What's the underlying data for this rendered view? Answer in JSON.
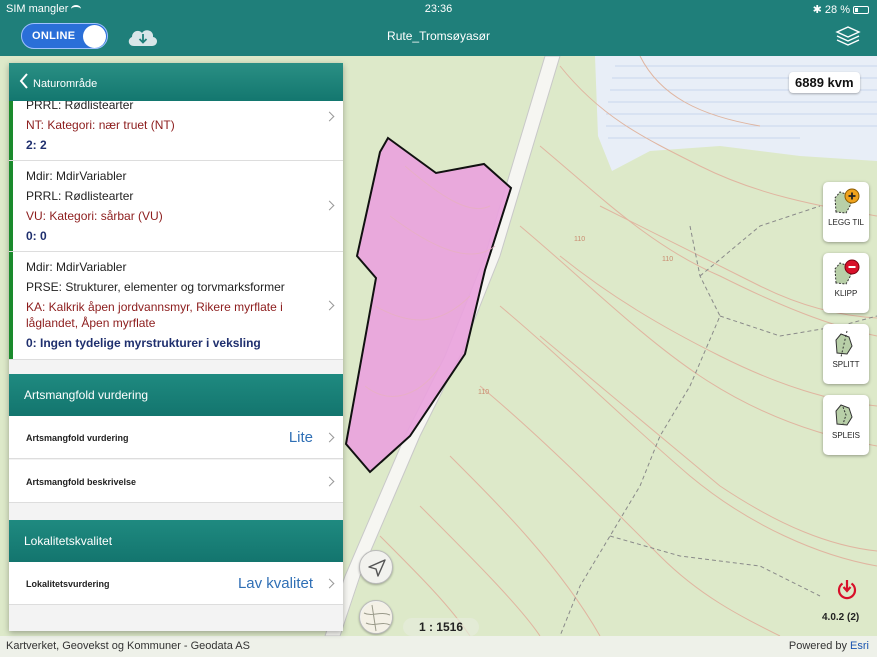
{
  "status_bar": {
    "carrier": "SIM mangler",
    "time": "23:36",
    "battery": "28 %"
  },
  "nav_bar": {
    "toggle_label": "ONLINE",
    "title": "Rute_Tromsøyasør"
  },
  "map": {
    "area_label": "6889 kvm",
    "scale": "1 : 1516",
    "version": "4.0.2 (2)",
    "contour_labels": [
      "110",
      "110",
      "110"
    ]
  },
  "tools": [
    {
      "label": "LEGG TIL"
    },
    {
      "label": "KLIPP"
    },
    {
      "label": "SPLITT"
    },
    {
      "label": "SPLEIS"
    }
  ],
  "footer": {
    "attribution": "Kartverket, Geovekst og Kommuner - Geodata AS",
    "powered_by": "Powered by",
    "brand": "Esri"
  },
  "panel": {
    "back_label": "Naturområde",
    "records": [
      {
        "lines": [
          "PRRL: Rødlistearter",
          "NT: Kategori: nær truet (NT)",
          "2: 2"
        ]
      },
      {
        "lines": [
          "Mdir: MdirVariabler",
          "PRRL: Rødlistearter",
          "VU: Kategori: sårbar (VU)",
          "0: 0"
        ]
      },
      {
        "lines": [
          "Mdir: MdirVariabler",
          "PRSE: Strukturer, elementer og torvmarksformer",
          "KA: Kalkrik åpen jordvannsmyr, Rikere myrflate i",
          "låglandet, Åpen myrflate",
          "0: Ingen tydelige myrstrukturer i veksling"
        ]
      }
    ],
    "sections": [
      {
        "title": "Artsmangfold vurdering",
        "fields": [
          {
            "label": "Artsmangfold vurdering",
            "value": "Lite"
          },
          {
            "label": "Artsmangfold beskrivelse",
            "value": ""
          }
        ]
      },
      {
        "title": "Lokalitetskvalitet",
        "fields": [
          {
            "label": "Lokalitetsvurdering",
            "value": "Lav kvalitet"
          }
        ]
      }
    ]
  },
  "colors": {
    "header_teal": "#1f7f7a",
    "polygon_fill": "#e9a3dd",
    "value_blue": "#2f6fb5",
    "record_red": "#8c1c1c"
  }
}
